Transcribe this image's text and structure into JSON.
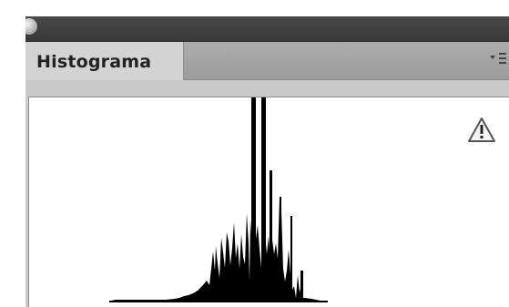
{
  "panel": {
    "title": "Histograma"
  },
  "icons": {
    "collapse": "collapse-dot-icon",
    "menu": "panel-menu-icon",
    "warning": "warning-icon"
  },
  "colors": {
    "titlebar": "#3e3e3e",
    "panel": "#c9c9c9",
    "tab": "#d3d3d3",
    "graph_background": "#ffffff",
    "histogram": "#000000"
  },
  "chart_data": {
    "type": "histogram",
    "title": "",
    "xlabel": "",
    "ylabel": "",
    "x_range": [
      0,
      255
    ],
    "peak_region": [
      82,
      96
    ],
    "tallest_bins": [
      96,
      100
    ],
    "grid": false,
    "legend": false
  }
}
